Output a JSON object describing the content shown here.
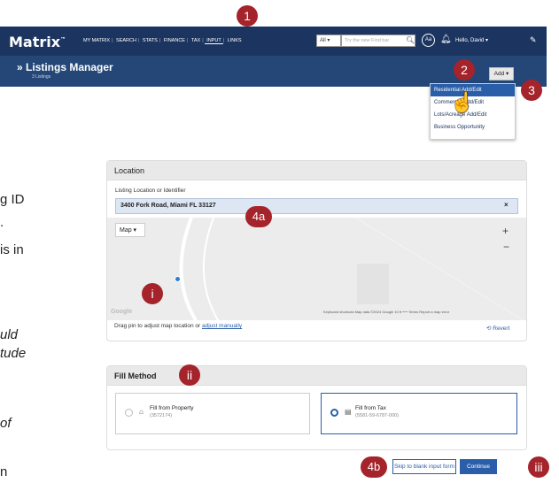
{
  "header": {
    "logo": "Matrix",
    "logo_tm": "™",
    "nav": [
      "MY MATRIX",
      "SEARCH",
      "STATS",
      "FINANCE",
      "TAX",
      "INPUT",
      "LINKS"
    ],
    "search_scope": "All ▾",
    "search_placeholder": "Try the new Find bar",
    "aa": "Aa",
    "user": "Hello, David ▾"
  },
  "subheader": {
    "title": "» Listings Manager",
    "subtitle": "3 Listings",
    "add_button": "Add ▾"
  },
  "add_menu": [
    "Residential Add/Edit",
    "Commercial Add/Edit",
    "Lots/Acreage Add/Edit",
    "Business Opportunity"
  ],
  "badges": {
    "b1": "1",
    "b2": "2",
    "b3": "3",
    "b4a": "4a",
    "bi": "i",
    "bii": "ii",
    "b4b": "4b",
    "biii": "iii"
  },
  "left_text": [
    "g ID",
    ".",
    "is in",
    "uld",
    "tude",
    "of",
    "n"
  ],
  "location": {
    "heading": "Location",
    "field_label": "Listing Location or Identifier",
    "field_value": "3400 Fork Road, Miami FL 33127",
    "clear": "×",
    "map_type": "Map ▾",
    "zoom_in": "+",
    "zoom_out": "−",
    "google": "Google",
    "map_footer": "Keyboard shortcuts   Map data ©2024 Google   10 ft ⎯⎯⎯   Terms   Report a map error",
    "drag_text": "Drag pin to adjust map location or ",
    "drag_link": "adjust manually",
    "revert": "⟲ Revert"
  },
  "fill_method": {
    "heading": "Fill Method",
    "options": [
      {
        "name": "Fill from Property",
        "sub": "(3572174)",
        "selected": false
      },
      {
        "name": "Fill from Tax",
        "sub": "(5581-59-6787-000)",
        "selected": true
      }
    ]
  },
  "buttons": {
    "skip": "Skip to blank input form",
    "continue": "Continue"
  },
  "colors": {
    "nav": "#1c3560",
    "subnav": "#244777",
    "accent": "#2a5ea8",
    "badge": "#a5232a"
  }
}
